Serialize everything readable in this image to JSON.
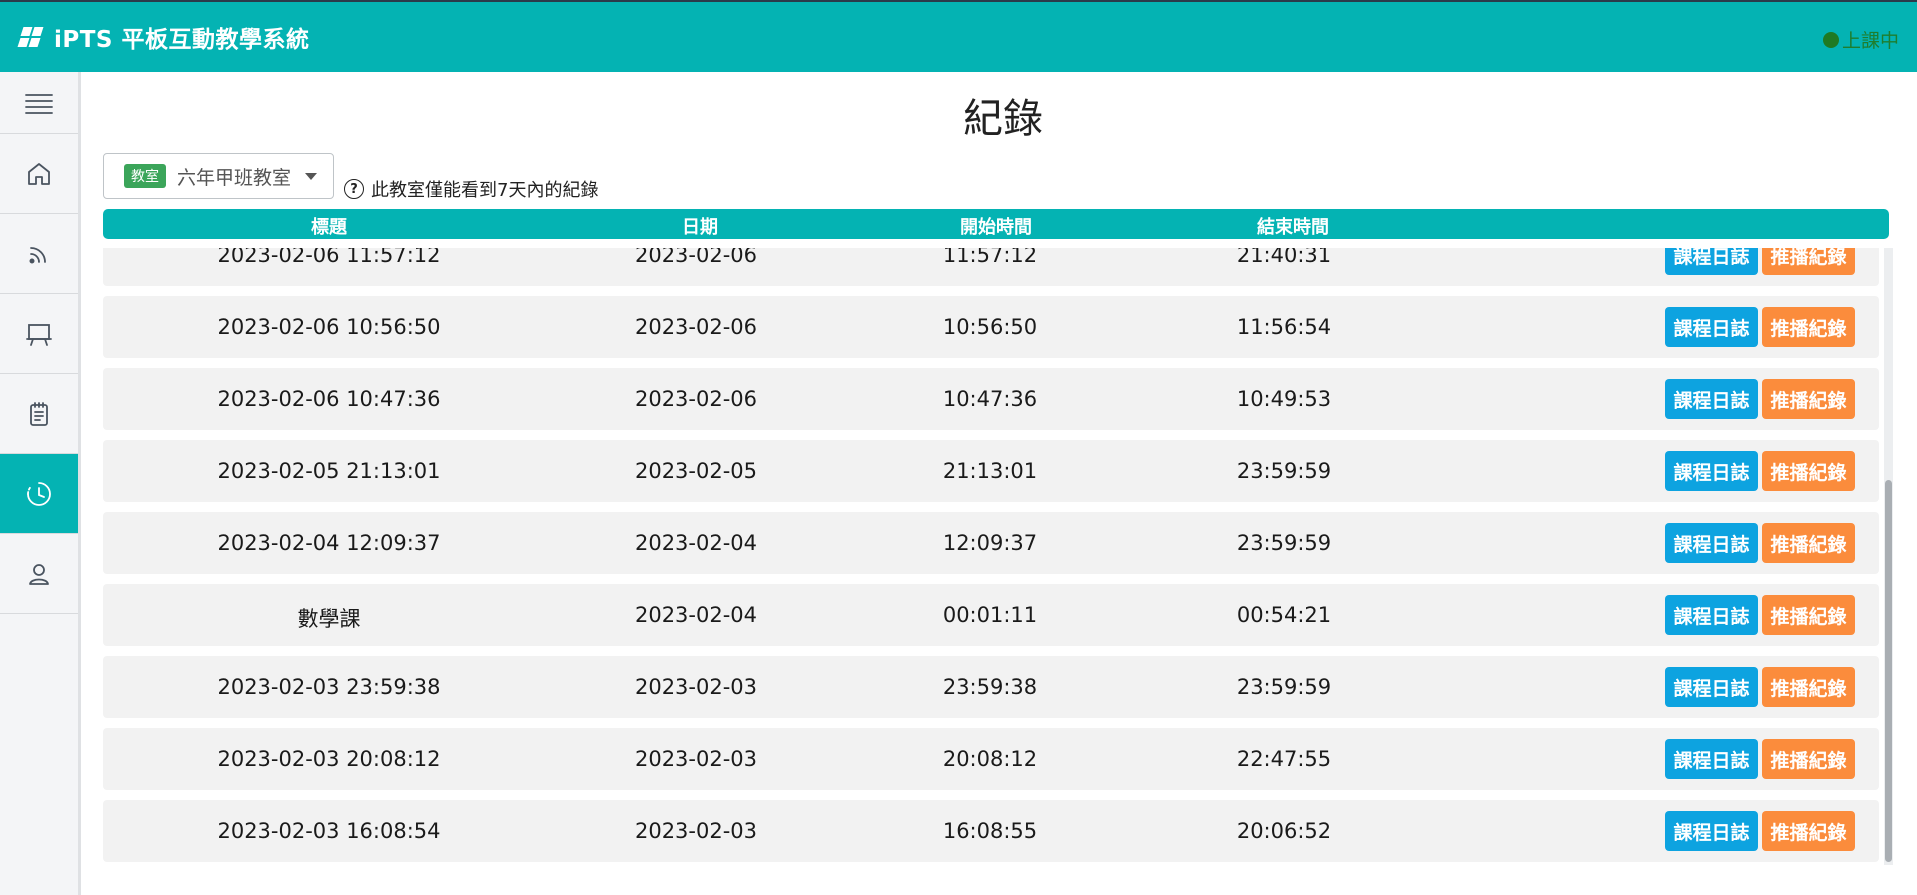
{
  "app": {
    "title": "iPTS 平板互動教學系統",
    "status": "上課中",
    "accent_color": "#04b3b3",
    "status_color": "#1f7a23"
  },
  "sidebar": {
    "items": [
      {
        "icon": "menu-icon",
        "active": false
      },
      {
        "icon": "home-icon",
        "active": false
      },
      {
        "icon": "broadcast-icon",
        "active": false
      },
      {
        "icon": "classroom-board-icon",
        "active": false
      },
      {
        "icon": "notes-icon",
        "active": false
      },
      {
        "icon": "clock-history-icon",
        "active": true
      },
      {
        "icon": "user-icon",
        "active": false
      }
    ]
  },
  "page": {
    "title": "紀錄",
    "room_badge": "教室",
    "room_name": "六年甲班教室",
    "hint_icon": "?",
    "hint": "此教室僅能看到7天內的紀錄"
  },
  "table": {
    "headers": [
      "標題",
      "日期",
      "開始時間",
      "結束時間"
    ],
    "log_button": "課程日誌",
    "push_button": "推播紀錄",
    "rows": [
      {
        "title": "2023-02-06 11:57:12",
        "date": "2023-02-06",
        "start": "11:57:12",
        "end": "21:40:31"
      },
      {
        "title": "2023-02-06 10:56:50",
        "date": "2023-02-06",
        "start": "10:56:50",
        "end": "11:56:54"
      },
      {
        "title": "2023-02-06 10:47:36",
        "date": "2023-02-06",
        "start": "10:47:36",
        "end": "10:49:53"
      },
      {
        "title": "2023-02-05 21:13:01",
        "date": "2023-02-05",
        "start": "21:13:01",
        "end": "23:59:59"
      },
      {
        "title": "2023-02-04 12:09:37",
        "date": "2023-02-04",
        "start": "12:09:37",
        "end": "23:59:59"
      },
      {
        "title": "數學課",
        "date": "2023-02-04",
        "start": "00:01:11",
        "end": "00:54:21"
      },
      {
        "title": "2023-02-03 23:59:38",
        "date": "2023-02-03",
        "start": "23:59:38",
        "end": "23:59:59"
      },
      {
        "title": "2023-02-03 20:08:12",
        "date": "2023-02-03",
        "start": "20:08:12",
        "end": "22:47:55"
      },
      {
        "title": "2023-02-03 16:08:54",
        "date": "2023-02-03",
        "start": "16:08:55",
        "end": "20:06:52"
      }
    ]
  },
  "colors": {
    "log_button": "#0da3e0",
    "push_button": "#fb8c3c",
    "room_badge": "#3ba55a"
  }
}
